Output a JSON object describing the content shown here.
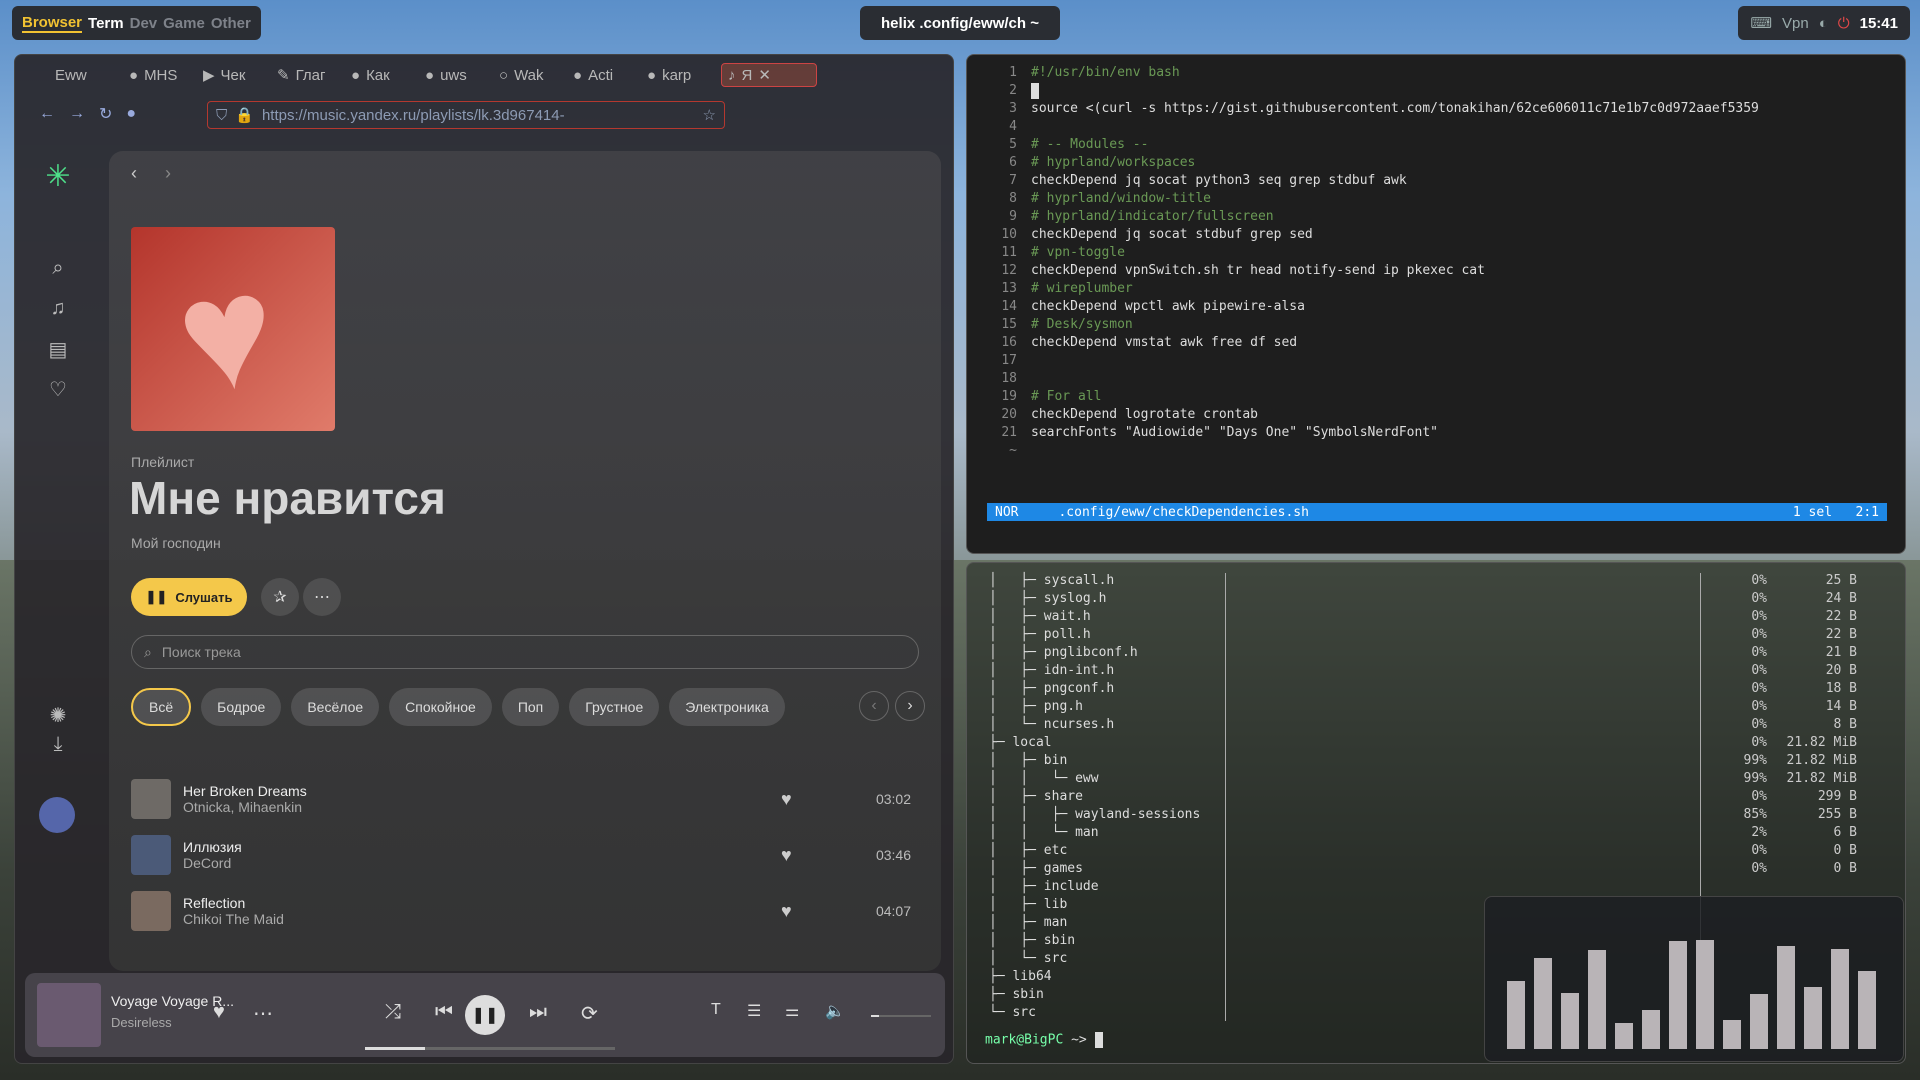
{
  "topbar": {
    "workspaces": [
      "Browser",
      "Term",
      "Dev",
      "Game",
      "Other"
    ],
    "active_workspace": "Browser",
    "window_title": "helix .config/eww/ch ~",
    "tray": {
      "vpn": "Vpn",
      "clock": "15:41"
    }
  },
  "browser": {
    "tabs": [
      "Eww",
      "MHS",
      "Чек",
      "Глаг",
      "Как",
      "uws",
      "Wak",
      "Acti",
      "karp",
      "Я"
    ],
    "url": "https://music.yandex.ru/playlists/lk.3d967414-",
    "playlist": {
      "type": "Плейлист",
      "title": "Мне нравится",
      "owner": "Мой господин",
      "listen": "Слушать",
      "search_placeholder": "Поиск трека"
    },
    "chips": [
      "Всё",
      "Бодрое",
      "Весёлое",
      "Спокойное",
      "Поп",
      "Грустное",
      "Электроника"
    ],
    "tracks": [
      {
        "title": "Her Broken Dreams",
        "artist": "Otnicka, Mihaenkin",
        "duration": "03:02"
      },
      {
        "title": "Иллюзия",
        "artist": "DeCord",
        "duration": "03:46"
      },
      {
        "title": "Reflection",
        "artist": "Chikoi The Maid",
        "duration": "04:07"
      }
    ],
    "player": {
      "title": "Voyage Voyage R...",
      "artist": "Desireless",
      "progress": 0.24,
      "volume": 0.13
    }
  },
  "editor": {
    "lines": [
      {
        "n": "1",
        "t": "#!/usr/bin/env bash",
        "c": "cm"
      },
      {
        "n": "2",
        "t": "",
        "c": "cursor"
      },
      {
        "n": "3",
        "t": "source <(curl -s https://gist.githubusercontent.com/tonakihan/62ce606011c71e1b7c0d972aaef5359",
        "c": ""
      },
      {
        "n": "4",
        "t": "",
        "c": ""
      },
      {
        "n": "5",
        "t": "# -- Modules --",
        "c": "cm"
      },
      {
        "n": "6",
        "t": "# hyprland/workspaces",
        "c": "cm"
      },
      {
        "n": "7",
        "t": "checkDepend jq socat python3 seq grep stdbuf awk",
        "c": ""
      },
      {
        "n": "8",
        "t": "# hyprland/window-title",
        "c": "cm"
      },
      {
        "n": "9",
        "t": "# hyprland/indicator/fullscreen",
        "c": "cm"
      },
      {
        "n": "10",
        "t": "checkDepend jq socat stdbuf grep sed",
        "c": ""
      },
      {
        "n": "11",
        "t": "# vpn-toggle",
        "c": "cm"
      },
      {
        "n": "12",
        "t": "checkDepend vpnSwitch.sh tr head notify-send ip pkexec cat",
        "c": ""
      },
      {
        "n": "13",
        "t": "# wireplumber",
        "c": "cm"
      },
      {
        "n": "14",
        "t": "checkDepend wpctl awk pipewire-alsa",
        "c": ""
      },
      {
        "n": "15",
        "t": "# Desk/sysmon",
        "c": "cm"
      },
      {
        "n": "16",
        "t": "checkDepend vmstat awk free df sed",
        "c": ""
      },
      {
        "n": "17",
        "t": "",
        "c": ""
      },
      {
        "n": "18",
        "t": "",
        "c": ""
      },
      {
        "n": "19",
        "t": "# For all",
        "c": "cm"
      },
      {
        "n": "20",
        "t": "checkDepend logrotate crontab",
        "c": ""
      },
      {
        "n": "21",
        "t": "searchFonts \"Audiowide\" \"Days One\" \"SymbolsNerdFont\"",
        "c": ""
      },
      {
        "n": "~",
        "t": "",
        "c": ""
      }
    ],
    "status": {
      "mode": "NOR",
      "file": ".config/eww/checkDependencies.sh",
      "sel": "1 sel",
      "pos": "2:1"
    }
  },
  "tree": {
    "rows": [
      {
        "name": "│   ├─ syscall.h",
        "pct": "0%",
        "size": "25 B"
      },
      {
        "name": "│   ├─ syslog.h",
        "pct": "0%",
        "size": "24 B"
      },
      {
        "name": "│   ├─ wait.h",
        "pct": "0%",
        "size": "22 B"
      },
      {
        "name": "│   ├─ poll.h",
        "pct": "0%",
        "size": "22 B"
      },
      {
        "name": "│   ├─ pnglibconf.h",
        "pct": "0%",
        "size": "21 B"
      },
      {
        "name": "│   ├─ idn-int.h",
        "pct": "0%",
        "size": "20 B"
      },
      {
        "name": "│   ├─ pngconf.h",
        "pct": "0%",
        "size": "18 B"
      },
      {
        "name": "│   ├─ png.h",
        "pct": "0%",
        "size": "14 B"
      },
      {
        "name": "│   └─ ncurses.h",
        "pct": "0%",
        "size": "8 B"
      },
      {
        "name": "├─ local",
        "pct": "0%",
        "size": "21.82 MiB"
      },
      {
        "name": "│   ├─ bin",
        "pct": "99%",
        "size": "21.82 MiB"
      },
      {
        "name": "│   │   └─ eww",
        "pct": "99%",
        "size": "21.82 MiB"
      },
      {
        "name": "│   ├─ share",
        "pct": "0%",
        "size": "299 B"
      },
      {
        "name": "│   │   ├─ wayland-sessions",
        "pct": "85%",
        "size": "255 B"
      },
      {
        "name": "│   │   └─ man",
        "pct": "2%",
        "size": "6 B"
      },
      {
        "name": "│   ├─ etc",
        "pct": "0%",
        "size": "0 B"
      },
      {
        "name": "│   ├─ games",
        "pct": "0%",
        "size": "0 B"
      },
      {
        "name": "│   ├─ include",
        "pct": "",
        "size": ""
      },
      {
        "name": "│   ├─ lib",
        "pct": "",
        "size": ""
      },
      {
        "name": "│   ├─ man",
        "pct": "",
        "size": ""
      },
      {
        "name": "│   ├─ sbin",
        "pct": "",
        "size": ""
      },
      {
        "name": "│   └─ src",
        "pct": "",
        "size": ""
      },
      {
        "name": "├─ lib64",
        "pct": "",
        "size": ""
      },
      {
        "name": "├─ sbin",
        "pct": "",
        "size": ""
      },
      {
        "name": "└─ src",
        "pct": "",
        "size": ""
      }
    ],
    "prompt_user": "mark@BigPC",
    "prompt_tail": " ~> "
  },
  "visualizer": {
    "levels": [
      0.52,
      0.7,
      0.43,
      0.76,
      0.2,
      0.3,
      0.83,
      0.84,
      0.22,
      0.42,
      0.79,
      0.48,
      0.77,
      0.6
    ]
  }
}
